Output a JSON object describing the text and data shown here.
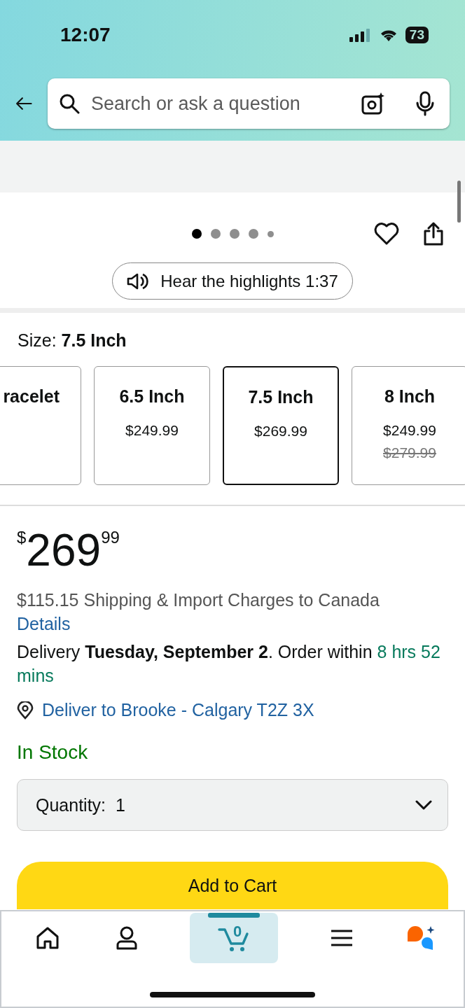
{
  "status_bar": {
    "time": "12:07",
    "battery": "73"
  },
  "search": {
    "placeholder": "Search or ask a question"
  },
  "carousel": {
    "dots": [
      {
        "selected": true
      },
      {
        "selected": false
      },
      {
        "selected": false
      },
      {
        "selected": false
      },
      {
        "selected": false
      }
    ]
  },
  "highlights_button": "Hear the highlights 1:37",
  "size": {
    "label": "Size: ",
    "value": "7.5 Inch",
    "options": [
      {
        "label": "racelet",
        "selected": false
      },
      {
        "label": "6.5 Inch",
        "price": "$249.99",
        "selected": false
      },
      {
        "label": "7.5 Inch",
        "price": "$269.99",
        "selected": true
      },
      {
        "label": "8 Inch",
        "price": "$249.99",
        "list_price": "$279.99",
        "selected": false
      }
    ]
  },
  "price": {
    "symbol": "$",
    "whole": "269",
    "fraction": "99"
  },
  "shipping": {
    "text": "$115.15 Shipping & Import Charges to Canada",
    "link": "Details"
  },
  "delivery": {
    "text": "Delivery **Tuesday, September 2**. Order within ",
    "countdown": "8 hrs 52 mins"
  },
  "location": "Deliver to Brooke - Calgary T2Z 3X",
  "stock": "In Stock",
  "quantity": "Quantity:  1",
  "add_to_cart": "Add to Cart",
  "nav": [
    {
      "kind": "home",
      "selected": false
    },
    {
      "kind": "account",
      "selected": false
    },
    {
      "kind": "cart",
      "selected": true,
      "count": "0"
    },
    {
      "kind": "menu",
      "selected": false
    },
    {
      "kind": "assistant",
      "selected": false
    }
  ]
}
